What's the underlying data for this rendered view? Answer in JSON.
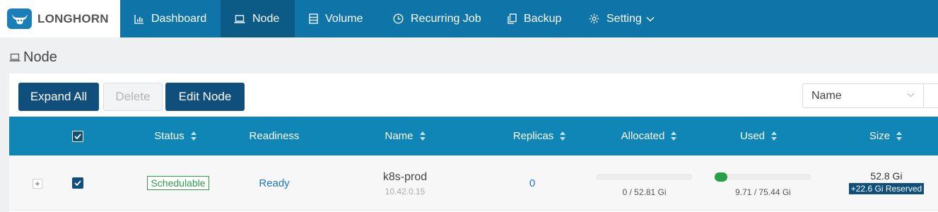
{
  "app": {
    "logo_text": "LONGHORN"
  },
  "nav": [
    {
      "label": "Dashboard",
      "icon": "bar-chart-icon",
      "active": false
    },
    {
      "label": "Node",
      "icon": "laptop-icon",
      "active": true
    },
    {
      "label": "Volume",
      "icon": "server-icon",
      "active": false
    },
    {
      "label": "Recurring Job",
      "icon": "clock-icon",
      "active": false
    },
    {
      "label": "Backup",
      "icon": "copy-icon",
      "active": false
    },
    {
      "label": "Setting",
      "icon": "gear-icon",
      "active": false,
      "has_dropdown": true
    }
  ],
  "page": {
    "title": "Node",
    "icon": "laptop-icon"
  },
  "toolbar": {
    "expand_all": "Expand All",
    "delete": "Delete",
    "edit_node": "Edit Node",
    "filter_select_value": "Name"
  },
  "table": {
    "columns": [
      {
        "label": "Status",
        "sortable": true
      },
      {
        "label": "Readiness",
        "sortable": false
      },
      {
        "label": "Name",
        "sortable": true
      },
      {
        "label": "Replicas",
        "sortable": true
      },
      {
        "label": "Allocated",
        "sortable": true
      },
      {
        "label": "Used",
        "sortable": true
      },
      {
        "label": "Size",
        "sortable": true
      }
    ],
    "rows": [
      {
        "expand": "+",
        "checked": true,
        "status": "Schedulable",
        "readiness": "Ready",
        "name": "k8s-prod",
        "ip": "10.42.0.15",
        "replicas": "0",
        "allocated_text": "0 / 52.81 Gi",
        "allocated_fraction": 0.0,
        "used_text": "9.71 / 75.44 Gi",
        "used_fraction": 0.13,
        "size": "52.8 Gi",
        "reserved": "+22.6 Gi Reserved"
      }
    ]
  },
  "colors": {
    "nav_bg": "#0f74a8",
    "nav_active": "#0b5b86",
    "table_header": "#0f86b6",
    "primary_button": "#104e7b",
    "schedulable": "#2e9e4b",
    "link": "#1b74c5",
    "used_bar": "#27a046"
  }
}
